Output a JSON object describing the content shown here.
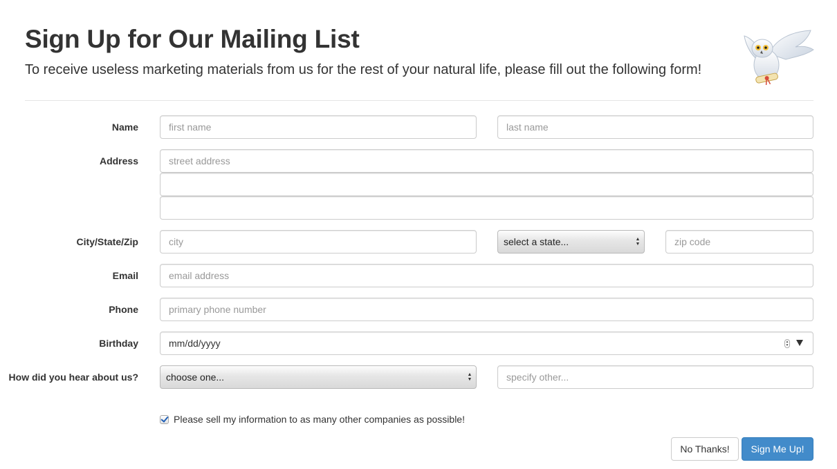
{
  "header": {
    "title": "Sign Up for Our Mailing List",
    "subtitle": "To receive useless marketing materials from us for the rest of your natural life, please fill out the following form!",
    "logo_icon": "owl-icon"
  },
  "form": {
    "name": {
      "label": "Name",
      "first_placeholder": "first name",
      "last_placeholder": "last name"
    },
    "address": {
      "label": "Address",
      "line1_placeholder": "street address",
      "line2_placeholder": "",
      "line3_placeholder": ""
    },
    "city_state_zip": {
      "label": "City/State/Zip",
      "city_placeholder": "city",
      "state_selected": "select a state...",
      "zip_placeholder": "zip code"
    },
    "email": {
      "label": "Email",
      "placeholder": "email address"
    },
    "phone": {
      "label": "Phone",
      "placeholder": "primary phone number"
    },
    "birthday": {
      "label": "Birthday",
      "value": "mm/dd/yyyy"
    },
    "referral": {
      "label": "How did you hear about us?",
      "selected": "choose one...",
      "other_placeholder": "specify other..."
    },
    "consent": {
      "checked": true,
      "label": "Please sell my information to as many other companies as possible!"
    }
  },
  "actions": {
    "cancel_label": "No Thanks!",
    "submit_label": "Sign Me Up!"
  },
  "colors": {
    "primary": "#428bca",
    "border": "#cccccc",
    "placeholder": "#999999",
    "text": "#333333"
  }
}
